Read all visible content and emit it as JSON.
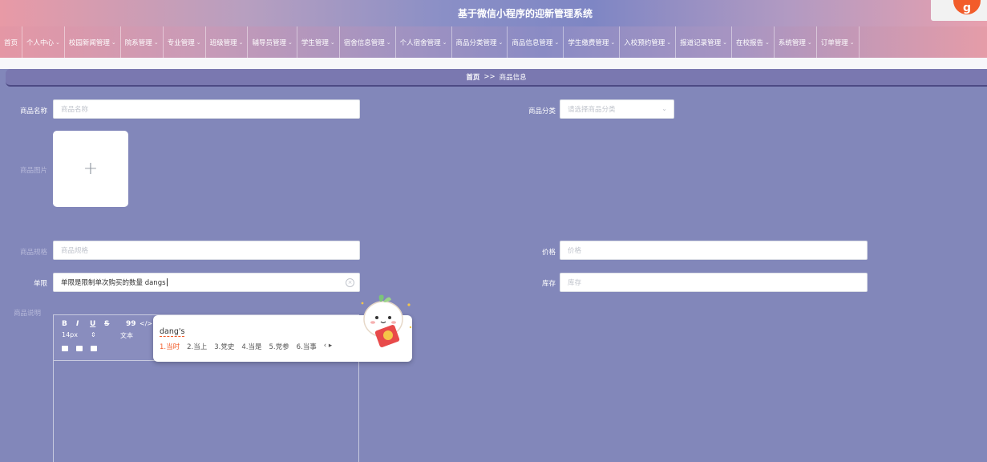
{
  "site": {
    "title": "基于微信小程序的迎新管理系统"
  },
  "nav": {
    "items": [
      {
        "label": "首页",
        "has_dropdown": false
      },
      {
        "label": "个人中心",
        "has_dropdown": true
      },
      {
        "label": "校园新闻管理",
        "has_dropdown": true
      },
      {
        "label": "院系管理",
        "has_dropdown": true
      },
      {
        "label": "专业管理",
        "has_dropdown": true
      },
      {
        "label": "班级管理",
        "has_dropdown": true
      },
      {
        "label": "辅导员管理",
        "has_dropdown": true
      },
      {
        "label": "学生管理",
        "has_dropdown": true
      },
      {
        "label": "宿舍信息管理",
        "has_dropdown": true
      },
      {
        "label": "个人宿舍管理",
        "has_dropdown": true
      },
      {
        "label": "商品分类管理",
        "has_dropdown": true
      },
      {
        "label": "商品信息管理",
        "has_dropdown": true
      },
      {
        "label": "学生缴费管理",
        "has_dropdown": true
      },
      {
        "label": "入校预约管理",
        "has_dropdown": true
      },
      {
        "label": "报道记录管理",
        "has_dropdown": true
      },
      {
        "label": "在校报告",
        "has_dropdown": true
      },
      {
        "label": "系统管理",
        "has_dropdown": true
      },
      {
        "label": "订单管理",
        "has_dropdown": true
      }
    ]
  },
  "breadcrumb": {
    "home": "首页",
    "separator": ">>",
    "current": "商品信息"
  },
  "form": {
    "name": {
      "label": "商品名称",
      "placeholder": "商品名称",
      "value": ""
    },
    "category": {
      "label": "商品分类",
      "placeholder": "请选择商品分类"
    },
    "image": {
      "label": "商品图片",
      "plus": "+"
    },
    "spec": {
      "label": "商品规格",
      "placeholder": "商品规格",
      "value": ""
    },
    "price": {
      "label": "价格",
      "placeholder": "价格",
      "value": ""
    },
    "limit": {
      "label": "单限",
      "value": "单限是限制单次购买的数量 dangs"
    },
    "stock": {
      "label": "库存",
      "placeholder": "库存",
      "value": ""
    },
    "description": {
      "label": "商品说明"
    }
  },
  "editor": {
    "toolbar": {
      "bold": "B",
      "italic": "I",
      "underline": "U",
      "strike": "S",
      "quote": "99",
      "code": "</>",
      "font_size": "14px",
      "font_size_arrow": "⇕",
      "text_style": "文本"
    }
  },
  "ime": {
    "composition": "dang's",
    "candidates": [
      "1.当时",
      "2.当上",
      "3.党史",
      "4.当是",
      "5.党参",
      "6.当事"
    ],
    "nav": "‹ ▸"
  },
  "logo": {
    "glyph": "g"
  },
  "colors": {
    "page_bg": "#8287ba",
    "breadcrumb_bg": "#7a78b0",
    "ime_highlight": "#f25c2a"
  }
}
